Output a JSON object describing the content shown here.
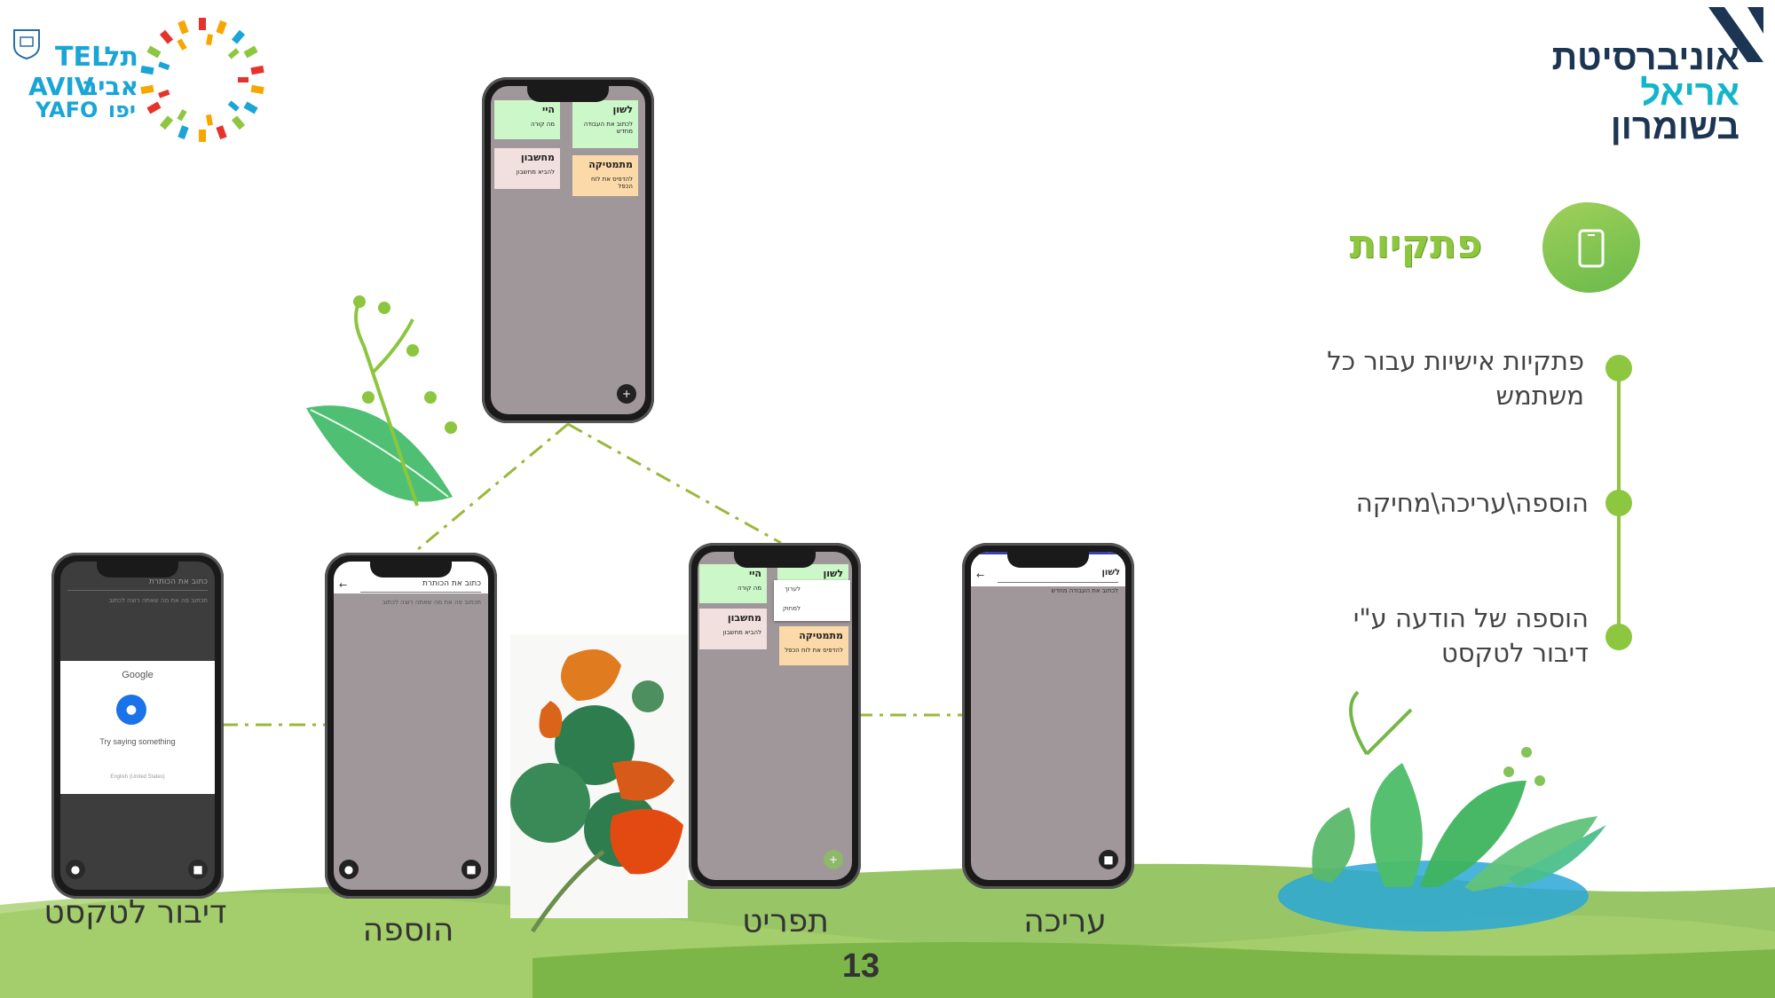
{
  "logos": {
    "tel_aviv": {
      "he_line1": "תל",
      "he_line2": "אביב",
      "he_line3": "יפו",
      "en_line1": "TEL",
      "en_line2": "AVIV",
      "en_line3": "YAFO"
    },
    "ariel": {
      "line1": "אוניברסיטת",
      "line2": "אריאל",
      "line3": "בשומרון"
    }
  },
  "section": {
    "title": "פתקיות",
    "icon": "phone-icon"
  },
  "bullets": [
    {
      "line1": "פתקיות אישיות עבור כל",
      "line2": "משתמש"
    },
    {
      "line1": "הוספה\\עריכה\\מחיקה",
      "line2": ""
    },
    {
      "line1": "הוספה של הודעה ע\"י",
      "line2": "דיבור לטקסט"
    }
  ],
  "phones": {
    "main": {
      "cards": [
        {
          "title": "לשון",
          "text": "לכתוב את העבודה מחדש"
        },
        {
          "title": "היי",
          "text": "מה קורה"
        },
        {
          "title": "מתמטיקה",
          "text": "להדפיס את לוח הכפל"
        },
        {
          "title": "מחשבון",
          "text": "להביא מחשבון"
        }
      ]
    },
    "menu": {
      "cards": [
        {
          "title": "לשון",
          "text": ""
        },
        {
          "title": "היי",
          "text": "מה קורה"
        },
        {
          "title": "מתמטיקה",
          "text": "להדפיס את לוח הכפל"
        },
        {
          "title": "מחשבון",
          "text": "להביא מחשבון"
        }
      ],
      "menu_items": [
        "לערוך",
        "למחוק"
      ]
    },
    "edit": {
      "title": "לשון",
      "text": "לכתוב את העבודה מחדש"
    },
    "add": {
      "title_placeholder": "כתוב את הכותרת",
      "body_placeholder": "תכתוב פה את מה שאתה רוצה לכתוב"
    },
    "speech": {
      "title_placeholder": "כתוב את הכותרת",
      "body_placeholder": "תכתוב פה את מה שאתה רוצה לכתוב",
      "google_label": "Google",
      "prompt": "Try saying something",
      "language": "English (United States)"
    }
  },
  "captions": {
    "speech": "דיבור לטקסט",
    "add": "הוספה",
    "menu": "תפריט",
    "edit": "עריכה"
  },
  "page_number": "13",
  "colors": {
    "accent_green": "#8dc63f",
    "ariel_teal": "#12b5c9",
    "ground_green": "#8dc057"
  }
}
